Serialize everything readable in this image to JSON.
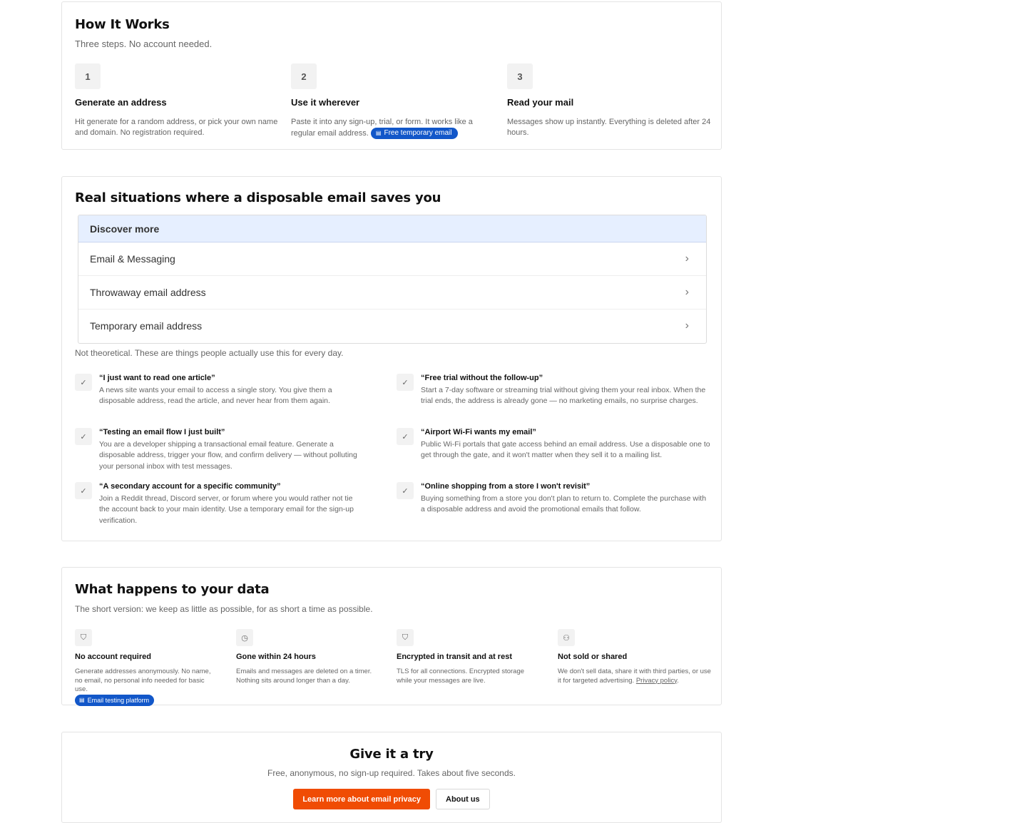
{
  "how": {
    "title": "How It Works",
    "subtitle": "Three steps. No account needed.",
    "steps": [
      {
        "num": "1",
        "title": "Generate an address",
        "desc": "Hit generate for a random address, or pick your own name and domain. No registration required."
      },
      {
        "num": "2",
        "title": "Use it wherever",
        "desc": "Paste it into any sign-up, trial, or form. It works like a regular email address.",
        "badge": "Free temporary email"
      },
      {
        "num": "3",
        "title": "Read your mail",
        "desc": "Messages show up instantly. Everything is deleted after 24 hours."
      }
    ]
  },
  "situations": {
    "title": "Real situations where a disposable email saves you",
    "discover": {
      "heading": "Discover more",
      "items": [
        "Email & Messaging",
        "Throwaway email address",
        "Temporary email address"
      ]
    },
    "subtitle": "Not theoretical. These are things people actually use this for every day.",
    "cases": [
      {
        "title": "“I just want to read one article”",
        "desc": "A news site wants your email to access a single story. You give them a disposable address, read the article, and never hear from them again."
      },
      {
        "title": "“Free trial without the follow-up”",
        "desc": "Start a 7-day software or streaming trial without giving them your real inbox. When the trial ends, the address is already gone — no marketing emails, no surprise charges."
      },
      {
        "title": "“Testing an email flow I just built”",
        "desc": "You are a developer shipping a transactional email feature. Generate a disposable address, trigger your flow, and confirm delivery — without polluting your personal inbox with test messages."
      },
      {
        "title": "“Airport Wi-Fi wants my email”",
        "desc": "Public Wi-Fi portals that gate access behind an email address. Use a disposable one to get through the gate, and it won't matter when they sell it to a mailing list."
      },
      {
        "title": "“A secondary account for a specific community”",
        "desc": "Join a Reddit thread, Discord server, or forum where you would rather not tie the account back to your main identity. Use a temporary email for the sign-up verification."
      },
      {
        "title": "“Online shopping from a store I won't revisit”",
        "desc": "Buying something from a store you don't plan to return to. Complete the purchase with a disposable address and avoid the promotional emails that follow."
      }
    ]
  },
  "data_section": {
    "title": "What happens to your data",
    "subtitle": "The short version: we keep as little as possible, for as short a time as possible.",
    "features": [
      {
        "icon": "shield-icon",
        "title": "No account required",
        "desc": "Generate addresses anonymously. No name, no email, no personal info needed for basic use.",
        "badge": "Email testing platform"
      },
      {
        "icon": "clock-icon",
        "title": "Gone within 24 hours",
        "desc": "Emails and messages are deleted on a timer. Nothing sits around longer than a day."
      },
      {
        "icon": "shield-icon",
        "title": "Encrypted in transit and at rest",
        "desc": "TLS for all connections. Encrypted storage while your messages are live."
      },
      {
        "icon": "users-icon",
        "title": "Not sold or shared",
        "desc": "We don't sell data, share it with third parties, or use it for targeted advertising.",
        "link": "Privacy policy"
      }
    ]
  },
  "try": {
    "title": "Give it a try",
    "subtitle": "Free, anonymous, no sign-up required. Takes about five seconds.",
    "primary_label": "Learn more about email privacy",
    "secondary_label": "About us"
  },
  "colors": {
    "accent": "#f04c04",
    "badge": "#1257c9",
    "discover_bg": "#e6efff"
  }
}
